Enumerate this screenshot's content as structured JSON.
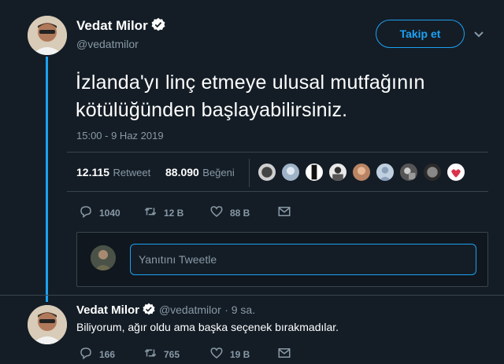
{
  "main_tweet": {
    "author_name": "Vedat Milor",
    "author_handle": "@vedatmilor",
    "follow_label": "Takip et",
    "text": "İzlanda'yı linç etmeye ulusal mutfağının kötülüğünden başlayabilirsiniz.",
    "timestamp": "15:00 - 9 Haz 2019",
    "retweet_count": "12.115",
    "retweet_label": "Retweet",
    "like_count": "88.090",
    "like_label": "Beğeni",
    "actions": {
      "replies": "1040",
      "retweets": "12 B",
      "likes": "88 B"
    },
    "liker_avatars": [
      "liker-1",
      "liker-2",
      "liker-3",
      "liker-4",
      "liker-5",
      "liker-6",
      "liker-7",
      "liker-8",
      "liker-9"
    ]
  },
  "reply_box": {
    "placeholder": "Yanıtını Tweetle"
  },
  "reply_tweet": {
    "author_name": "Vedat Milor",
    "author_handle": "@vedatmilor",
    "time": "· 9 sa.",
    "text": "Biliyorum, ağır oldu ama başka seçenek bırakmadılar.",
    "actions": {
      "replies": "166",
      "retweets": "765",
      "likes": "19 B"
    }
  },
  "colors": {
    "background": "#141d26",
    "accent": "#1da1f2",
    "muted": "#8899a6",
    "border": "#38444d"
  }
}
